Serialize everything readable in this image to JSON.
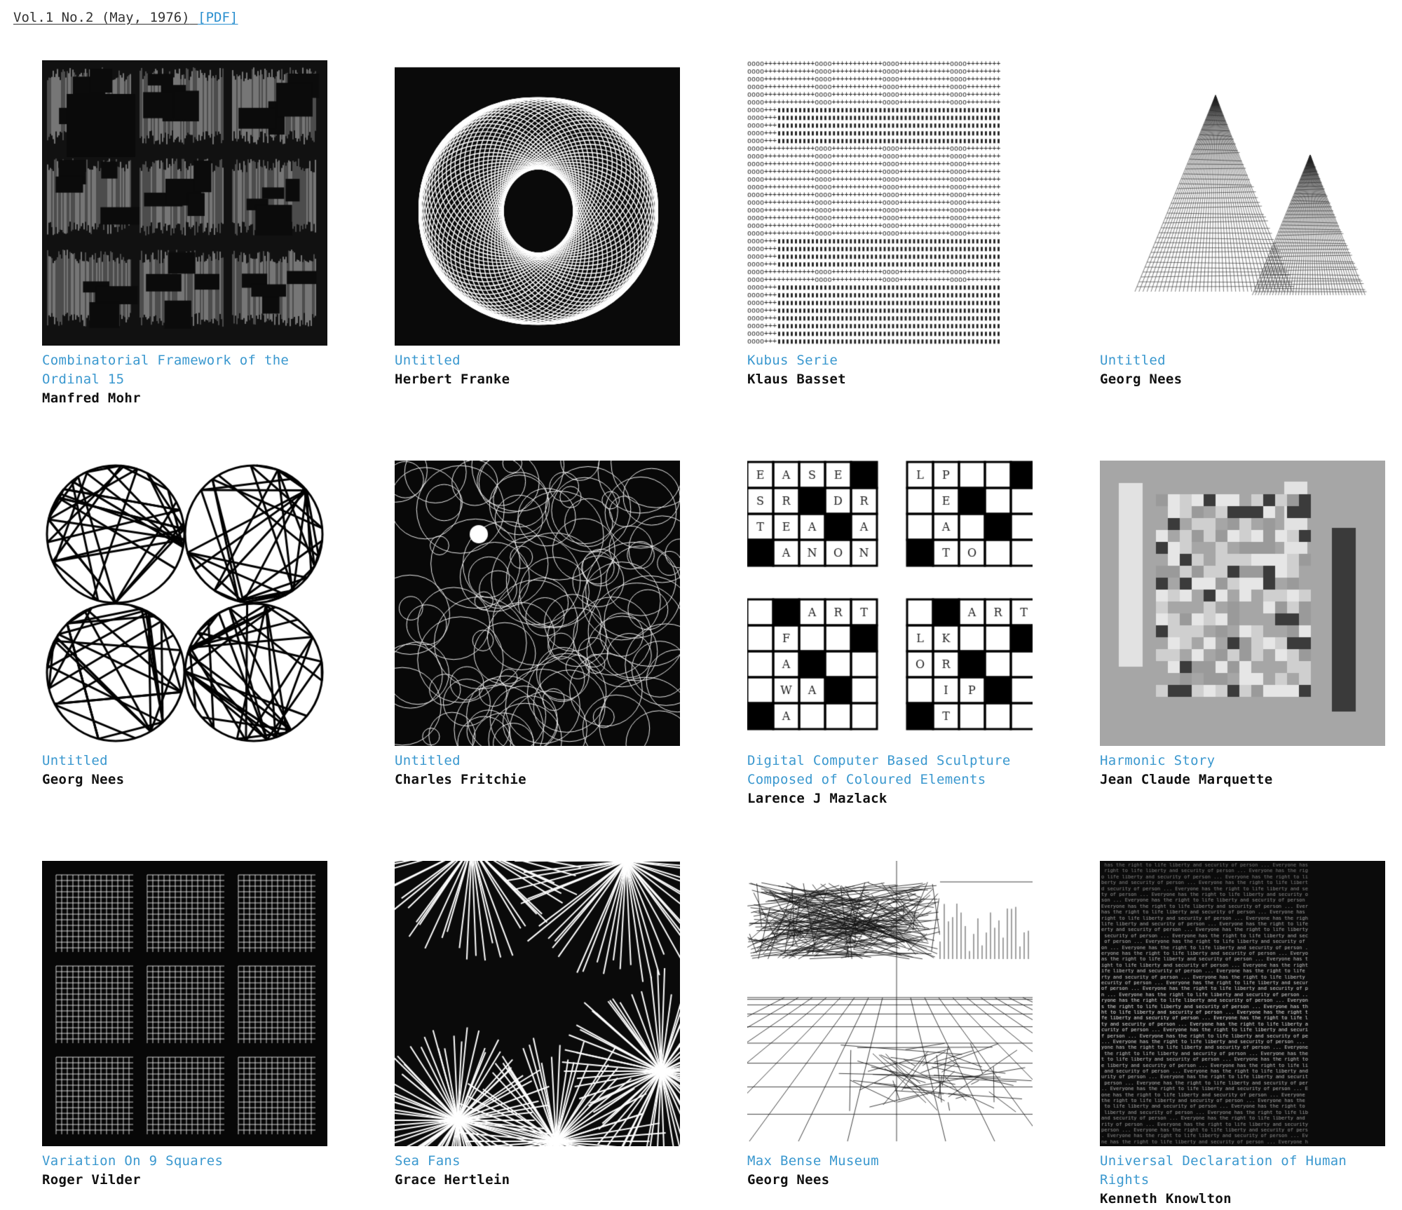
{
  "header": {
    "issue_label": "Vol.1 No.2 (May, 1976)",
    "pdf_link": "[PDF]"
  },
  "artworks": [
    {
      "title": "Combinatorial Framework of the Ordinal 15",
      "author": "Manfred Mohr",
      "art": "mohr-framework"
    },
    {
      "title": "Untitled",
      "author": "Herbert Franke",
      "art": "franke-sphere"
    },
    {
      "title": "Kubus Serie",
      "author": "Klaus Basset",
      "art": "basset-kubus"
    },
    {
      "title": "Untitled",
      "author": "Georg Nees",
      "art": "nees-pyramids"
    },
    {
      "title": "Untitled",
      "author": "Georg Nees",
      "art": "nees-circles"
    },
    {
      "title": "Untitled",
      "author": "Charles Fritchie",
      "art": "fritchie-loops"
    },
    {
      "title": "Digital Computer Based Sculpture Composed of Coloured Elements",
      "author": "Larence J Mazlack",
      "art": "mazlack-crosswords"
    },
    {
      "title": "Harmonic Story",
      "author": "Jean Claude Marquette",
      "art": "marquette-blocks"
    },
    {
      "title": "Variation On 9 Squares",
      "author": "Roger Vilder",
      "art": "vilder-squares"
    },
    {
      "title": "Sea Fans",
      "author": "Grace Hertlein",
      "art": "hertlein-fans"
    },
    {
      "title": "Max Bense Museum",
      "author": "Georg Nees",
      "art": "nees-museum"
    },
    {
      "title": "Universal Declaration of Human Rights",
      "author": "Kenneth Knowlton",
      "art": "knowlton-text"
    }
  ],
  "crossword_letters": {
    "tl": [
      [
        "E",
        "A",
        "S",
        "E",
        ""
      ],
      [
        "S",
        "R",
        "",
        "D",
        "R"
      ],
      [
        "T",
        "E",
        "A",
        "",
        "A"
      ],
      [
        "",
        "A",
        "N",
        "O",
        "N"
      ]
    ],
    "tr": [
      [
        "L",
        "P",
        "",
        "",
        ""
      ],
      [
        "",
        "E",
        "",
        "",
        ""
      ],
      [
        "",
        "A",
        "",
        "",
        ""
      ],
      [
        "",
        "T",
        "O",
        "",
        ""
      ]
    ],
    "bl": [
      [
        "",
        "",
        "A",
        "R",
        "T"
      ],
      [
        "",
        "F",
        "",
        "",
        ""
      ],
      [
        "",
        "A",
        "",
        "",
        ""
      ],
      [
        "",
        "W",
        "A",
        "",
        ""
      ],
      [
        "",
        "A",
        "",
        "",
        ""
      ]
    ],
    "br": [
      [
        "",
        "",
        "A",
        "R",
        "T"
      ],
      [
        "L",
        "K",
        "",
        "",
        ""
      ],
      [
        "O",
        "R",
        "",
        "",
        ""
      ],
      [
        "",
        "I",
        "P",
        "",
        ""
      ],
      [
        "",
        "T",
        "",
        "",
        ""
      ]
    ]
  }
}
